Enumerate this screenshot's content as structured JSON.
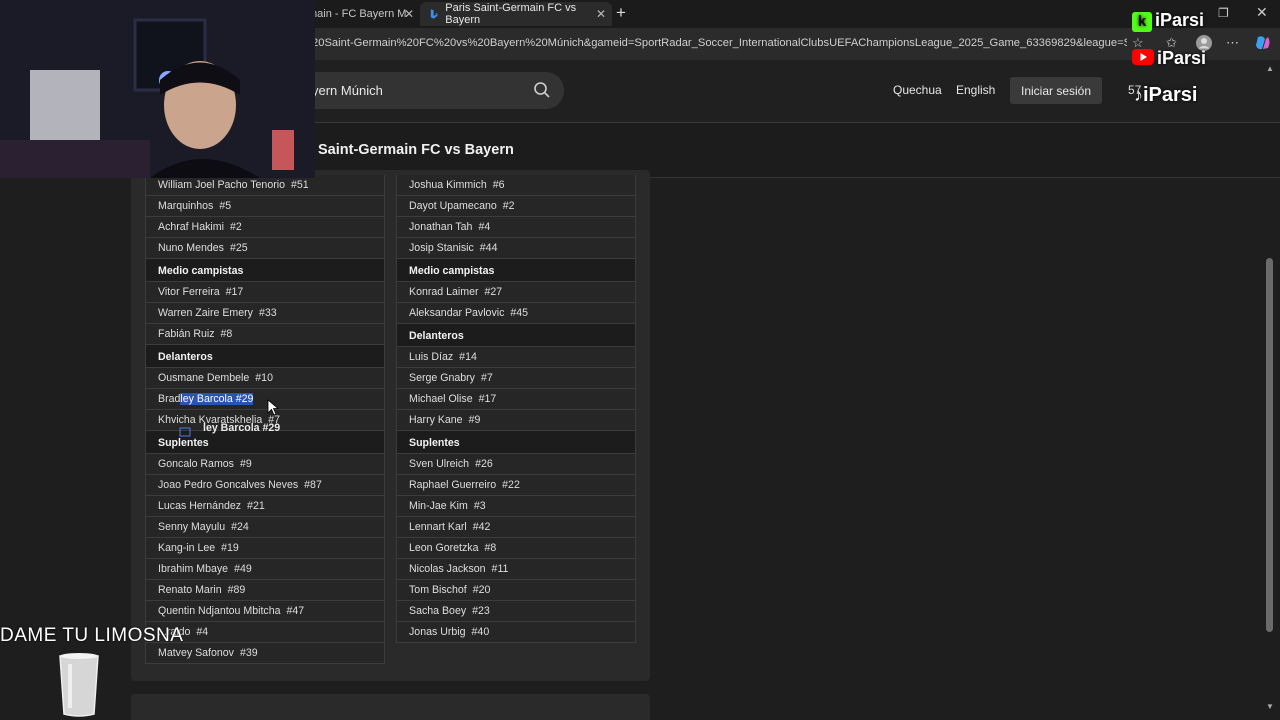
{
  "browser": {
    "tabs": [
      {
        "label": "main - FC Bayern M",
        "active": false
      },
      {
        "label": "Paris Saint-Germain FC vs Bayern",
        "active": true
      }
    ],
    "url": "20Saint-Germain%20FC%20vs%20Bayern%20Múnich&gameid=SportRadar_Soccer_InternationalClubsUEFAChampionsLeague_2025_Game_63369829&league=So..."
  },
  "header": {
    "search_value": "yern Múnich",
    "languages": [
      "Quechua",
      "English"
    ],
    "login_label": "Iniciar sesión",
    "points": "57"
  },
  "match": {
    "title": "Saint-Germain FC vs Bayern"
  },
  "lineups": {
    "left": {
      "defenders_partial": [
        {
          "name": "William Joel Pacho Tenorio",
          "num": "#51"
        },
        {
          "name": "Marquinhos",
          "num": "#5"
        },
        {
          "name": "Achraf Hakimi",
          "num": "#2"
        },
        {
          "name": "Nuno Mendes",
          "num": "#25"
        }
      ],
      "midfield_title": "Medio campistas",
      "midfielders": [
        {
          "name": "Vitor Ferreira",
          "num": "#17"
        },
        {
          "name": "Warren Zaire Emery",
          "num": "#33"
        },
        {
          "name": "Fabián Ruiz",
          "num": "#8"
        }
      ],
      "forwards_title": "Delanteros",
      "forwards": [
        {
          "name": "Ousmane Dembele",
          "num": "#10"
        },
        {
          "name": "Bradley Barcola",
          "num": "#29"
        },
        {
          "name": "Khvicha Kvaratskhelia",
          "num": "#7"
        }
      ],
      "subs_title": "Suplentes",
      "subs": [
        {
          "name": "Goncalo Ramos",
          "num": "#9"
        },
        {
          "name": "Joao Pedro Goncalves Neves",
          "num": "#87"
        },
        {
          "name": "Lucas Hernández",
          "num": "#21"
        },
        {
          "name": "Senny Mayulu",
          "num": "#24"
        },
        {
          "name": "Kang-in Lee",
          "num": "#19"
        },
        {
          "name": "Ibrahim Mbaye",
          "num": "#49"
        },
        {
          "name": "Renato Marin",
          "num": "#89"
        },
        {
          "name": "Quentin Ndjantou Mbitcha",
          "num": "#47"
        },
        {
          "name": "...raldo",
          "num": "#4"
        },
        {
          "name": "Matvey Safonov",
          "num": "#39"
        }
      ]
    },
    "right": {
      "defenders_partial": [
        {
          "name": "Joshua Kimmich",
          "num": "#6"
        },
        {
          "name": "Dayot Upamecano",
          "num": "#2"
        },
        {
          "name": "Jonathan Tah",
          "num": "#4"
        },
        {
          "name": "Josip Stanisic",
          "num": "#44"
        }
      ],
      "midfield_title": "Medio campistas",
      "midfielders": [
        {
          "name": "Konrad Laimer",
          "num": "#27"
        },
        {
          "name": "Aleksandar Pavlovic",
          "num": "#45"
        }
      ],
      "forwards_title": "Delanteros",
      "forwards": [
        {
          "name": "Luis Díaz",
          "num": "#14"
        },
        {
          "name": "Serge Gnabry",
          "num": "#7"
        },
        {
          "name": "Michael Olise",
          "num": "#17"
        },
        {
          "name": "Harry Kane",
          "num": "#9"
        }
      ],
      "subs_title": "Suplentes",
      "subs": [
        {
          "name": "Sven Ulreich",
          "num": "#26"
        },
        {
          "name": "Raphael Guerreiro",
          "num": "#22"
        },
        {
          "name": "Min-Jae Kim",
          "num": "#3"
        },
        {
          "name": "Lennart Karl",
          "num": "#42"
        },
        {
          "name": "Leon Goretzka",
          "num": "#8"
        },
        {
          "name": "Nicolas Jackson",
          "num": "#11"
        },
        {
          "name": "Tom Bischof",
          "num": "#20"
        },
        {
          "name": "Sacha Boey",
          "num": "#23"
        },
        {
          "name": "Jonas Urbig",
          "num": "#40"
        }
      ]
    }
  },
  "selection": {
    "plain": "Brad",
    "selected": "ley Barcola  #29",
    "drag_ghost": "ley Barcola #29"
  },
  "overlay": {
    "donation_text": "DAME TU LIMOSNA",
    "brand": "iParsi"
  },
  "colors": {
    "accent_blue": "#2d52b5",
    "tab_progress": [
      "#3b6fd8",
      "#7a7a7a"
    ]
  }
}
